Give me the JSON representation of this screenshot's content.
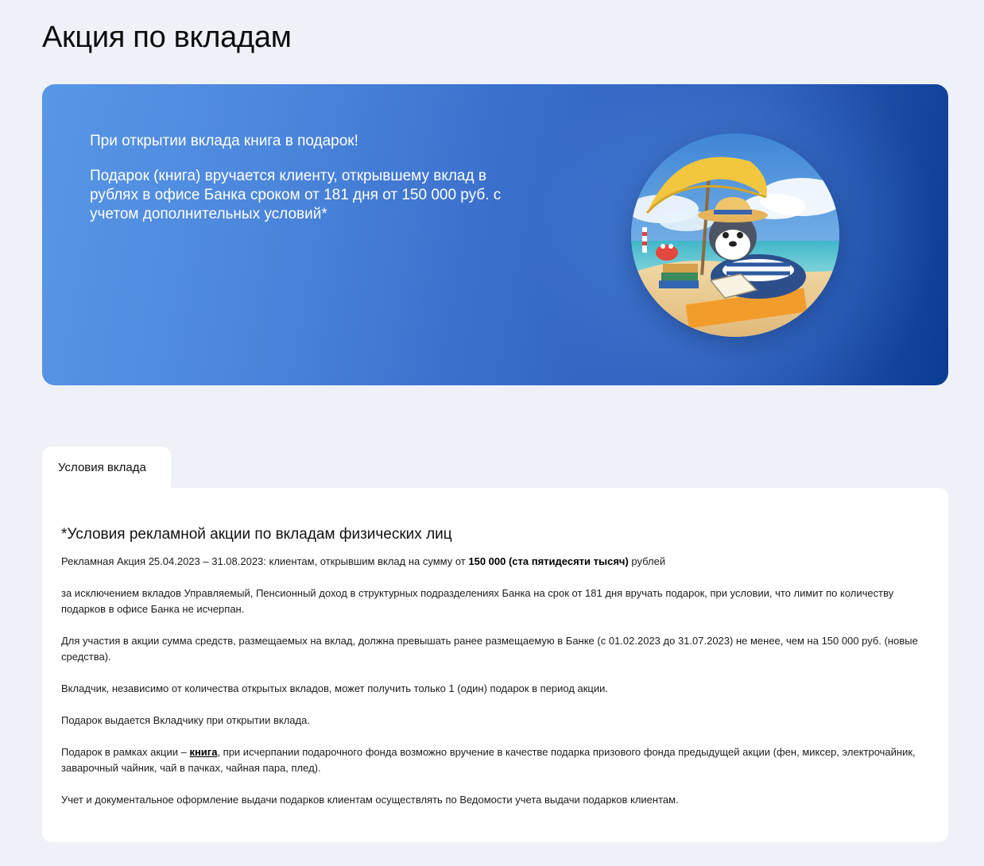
{
  "page": {
    "title": "Акция по вкладам"
  },
  "banner": {
    "headline": "При открытии вклада книга в подарок!",
    "description": "Подарок (книга) вручается клиенту, открывшему вклад в рублях в офисе Банка сроком от 181 дня от 150 000 руб. с учетом дополнительных условий*",
    "colors": {
      "start": "#5896e6",
      "end": "#0b3c93"
    }
  },
  "tabs": [
    {
      "label": "Условия вклада",
      "active": true
    }
  ],
  "conditions": {
    "title": "*Условия рекламной акции по вкладам физических лиц",
    "p1_before": "Рекламная Акция 25.04.2023 – 31.08.2023: клиентам, открывшим вклад на сумму от ",
    "p1_bold": "150 000 (ста пятидесяти тысяч)",
    "p1_after": " рублей",
    "p2": "за исключением вкладов Управляемый, Пенсионный доход в структурных подразделениях Банка на срок от 181 дня вручать подарок, при условии, что лимит по количеству подарков в офисе Банка не исчерпан.",
    "p3": "Для участия в акции сумма средств, размещаемых на вклад, должна превышать ранее размещаемую в Банке (с 01.02.2023 до 31.07.2023) не менее, чем на 150 000 руб. (новые средства).",
    "p4": "Вкладчик, независимо от количества открытых вкладов, может получить только 1 (один) подарок в период акции.",
    "p5": "Подарок выдается Вкладчику при открытии вклада.",
    "p6_before": "Подарок в рамках акции – ",
    "p6_link": "книга",
    "p6_after": ", при исчерпании подарочного фонда возможно вручение в качестве подарка призового фонда предыдущей акции (фен, миксер, электрочайник, заварочный чайник, чай в пачках, чайная пара, плед).",
    "p7": "Учет и документальное оформление выдачи подарков клиентам осуществлять по Ведомости учета выдачи подарков клиентам."
  }
}
